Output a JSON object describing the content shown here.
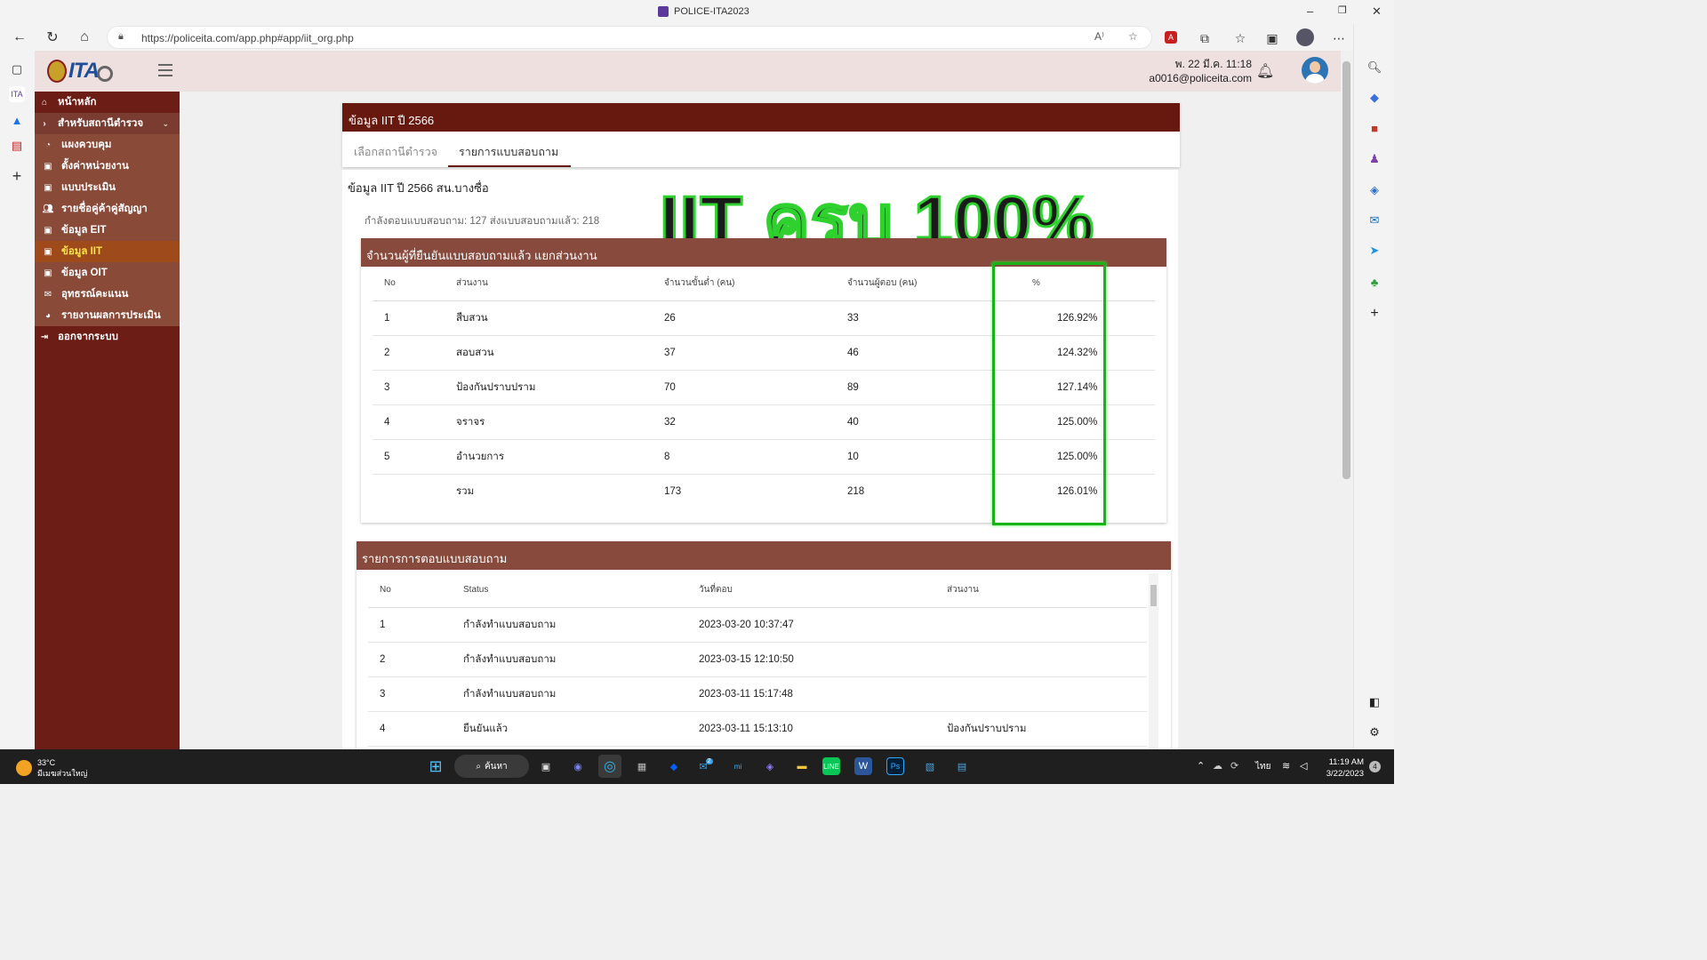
{
  "browser": {
    "window_title": "POLICE-ITA2023",
    "url": "https://policeita.com/app.php#app/iit_org.php",
    "icons": [
      "back-icon",
      "refresh-icon",
      "home-icon",
      "lock-icon",
      "read-aloud-icon",
      "favorite-add-icon",
      "pdf-icon",
      "extensions-icon",
      "favorites-icon",
      "collections-icon",
      "profile-icon",
      "more-icon",
      "bing-icon"
    ]
  },
  "window_controls": {
    "minimize": "–",
    "restore": "❐",
    "close": "✕"
  },
  "header": {
    "date": "พ. 22 มี.ค. 11:18",
    "email": "a0016@policeita.com"
  },
  "sidebar": {
    "items": [
      {
        "label": "หน้าหลัก",
        "icon": "home-icon"
      },
      {
        "label": "สำหรับสถานีตำรวจ",
        "icon": "chevron-circle-icon"
      },
      {
        "label": "แผงควบคุม",
        "icon": "dashboard-icon"
      },
      {
        "label": "ตั้งค่าหน่วยงาน",
        "icon": "briefcase-icon"
      },
      {
        "label": "แบบประเมิน",
        "icon": "briefcase-icon"
      },
      {
        "label": "รายชื่อคู่ค้าคู่สัญญา",
        "icon": "users-icon"
      },
      {
        "label": "ข้อมูล EIT",
        "icon": "briefcase-icon"
      },
      {
        "label": "ข้อมูล IIT",
        "icon": "briefcase-icon"
      },
      {
        "label": "ข้อมูล OIT",
        "icon": "briefcase-icon"
      },
      {
        "label": "อุทธรณ์คะแนน",
        "icon": "envelope-icon"
      },
      {
        "label": "รายงานผลการประเมิน",
        "icon": "pie-chart-icon"
      },
      {
        "label": "ออกจากระบบ",
        "icon": "sign-out-icon"
      }
    ]
  },
  "main": {
    "card_title": "ข้อมูล IIT ปี 2566",
    "tabs": [
      {
        "label": "เลือกสถานีตำรวจ"
      },
      {
        "label": "รายการแบบสอบถาม"
      }
    ],
    "subtitle": "ข้อมูล IIT ปี 2566 สน.บางซื่อ",
    "meta": "กำลังตอบแบบสอบถาม: 127 ส่งแบบสอบถามแล้ว: 218",
    "banner": "IIT ครบ 100%",
    "summary": {
      "title": "จำนวนผู้ที่ยืนยันแบบสอบถามแล้ว แยกส่วนงาน",
      "headers": [
        "No",
        "ส่วนงาน",
        "จำนวนขั้นต่ำ (คน)",
        "จำนวนผู้ตอบ (คน)",
        "%"
      ],
      "rows": [
        [
          "1",
          "สืบสวน",
          "26",
          "33",
          "126.92%"
        ],
        [
          "2",
          "สอบสวน",
          "37",
          "46",
          "124.32%"
        ],
        [
          "3",
          "ป้องกันปราบปราม",
          "70",
          "89",
          "127.14%"
        ],
        [
          "4",
          "จราจร",
          "32",
          "40",
          "125.00%"
        ],
        [
          "5",
          "อำนวยการ",
          "8",
          "10",
          "125.00%"
        ],
        [
          "",
          "รวม",
          "173",
          "218",
          "126.01%"
        ]
      ]
    },
    "responses": {
      "title": "รายการการตอบแบบสอบถาม",
      "headers": [
        "No",
        "Status",
        "วันที่ตอบ",
        "ส่วนงาน"
      ],
      "rows": [
        [
          "1",
          "กำลังทำแบบสอบถาม",
          "2023-03-20 10:37:47",
          ""
        ],
        [
          "2",
          "กำลังทำแบบสอบถาม",
          "2023-03-15 12:10:50",
          ""
        ],
        [
          "3",
          "กำลังทำแบบสอบถาม",
          "2023-03-11 15:17:48",
          ""
        ],
        [
          "4",
          "ยืนยันแล้ว",
          "2023-03-11 15:13:10",
          "ป้องกันปราบปราม"
        ]
      ]
    }
  },
  "taskbar": {
    "weather_temp": "33°C",
    "weather_desc": "มีเมฆส่วนใหญ่",
    "search_label": "ค้นหา",
    "mail_badge": "2",
    "language": "ไทย",
    "time": "11:19 AM",
    "date": "3/22/2023",
    "notification_count": "4"
  },
  "colors": {
    "sidebar_bg": "#6b1d16",
    "card_header": "#68190f",
    "section_header": "#874a3c",
    "active_item_text": "#ffe34d",
    "highlight_box": "#19b319"
  }
}
